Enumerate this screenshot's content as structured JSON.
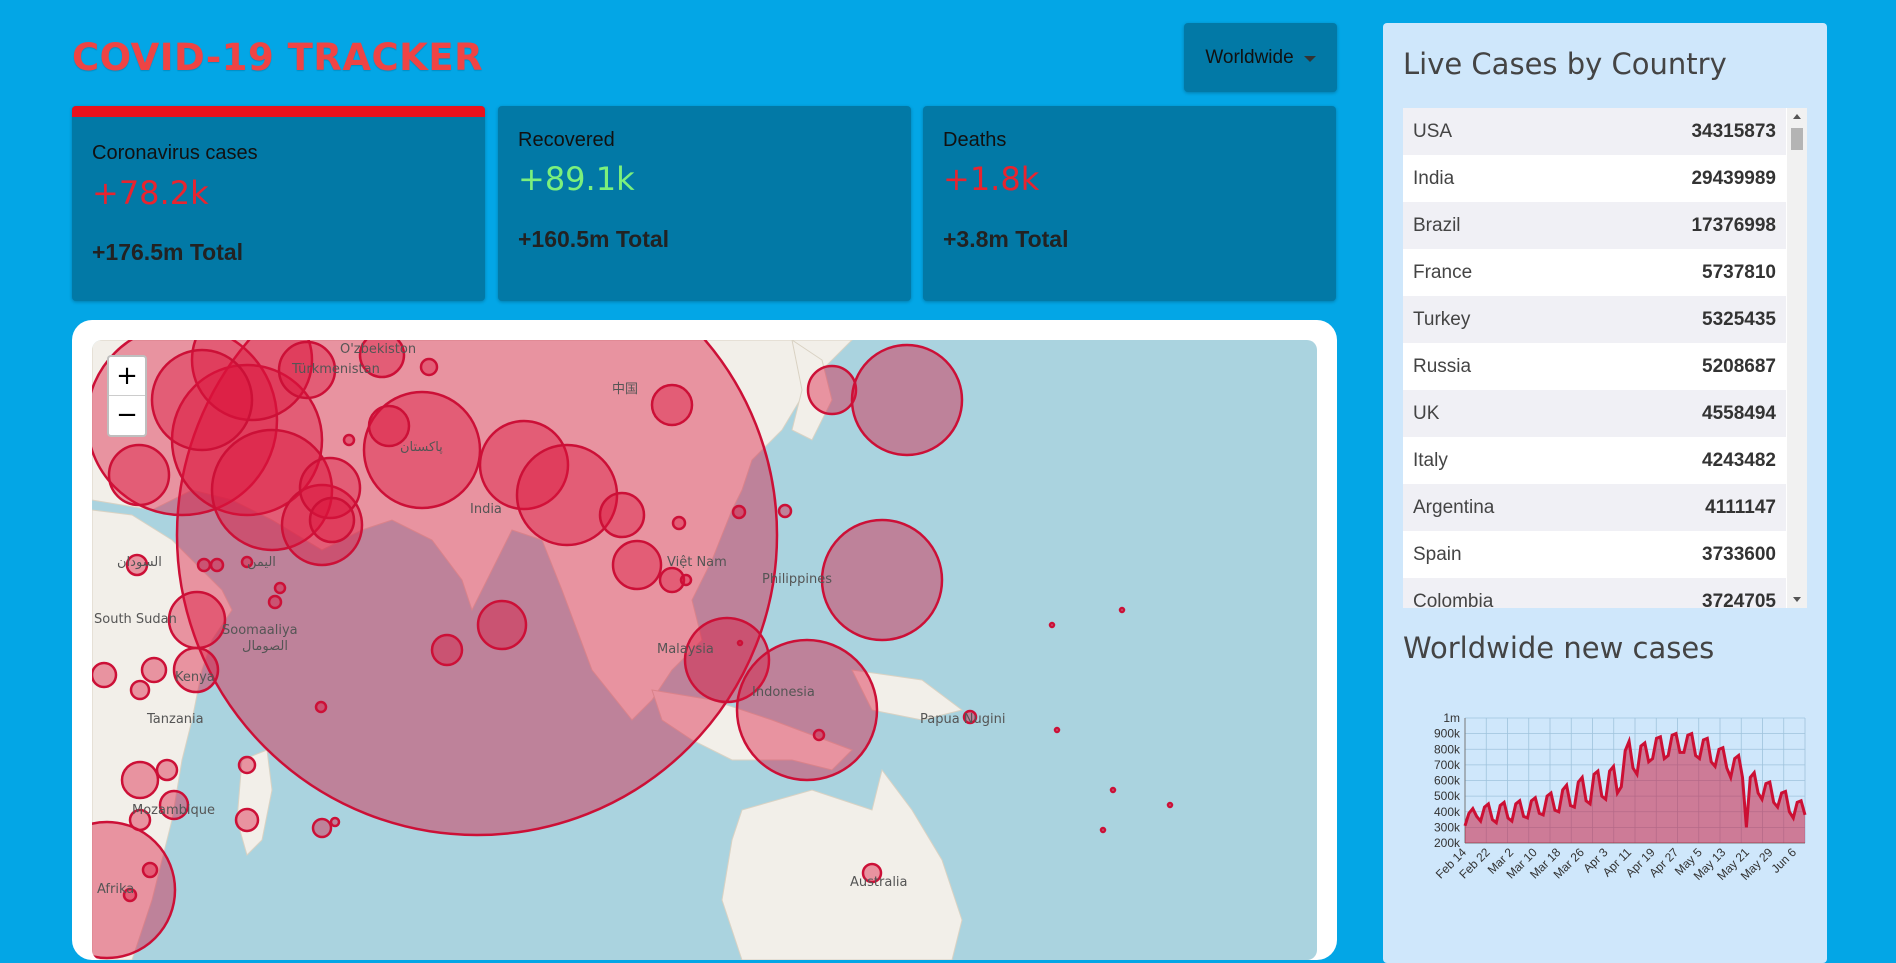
{
  "header": {
    "title": "COVID-19 TRACKER",
    "country_select": "Worldwide"
  },
  "stats": [
    {
      "label": "Coronavirus cases",
      "value": "+78.2k",
      "total": "+176.5m Total",
      "value_color": "#e8242f",
      "active": true
    },
    {
      "label": "Recovered",
      "value": "+89.1k",
      "total": "+160.5m Total",
      "value_color": "#7cf07c",
      "active": false
    },
    {
      "label": "Deaths",
      "value": "+1.8k",
      "total": "+3.8m Total",
      "value_color": "#e8242f",
      "active": false
    }
  ],
  "map": {
    "zoom_in": "+",
    "zoom_out": "−",
    "labels": [
      "O'zbekiston",
      "Türkmenistan",
      "中国",
      "پاکستان",
      "India",
      "Việt Nam",
      "Philippines",
      "Malaysia",
      "Indonesia",
      "Papua Nugini",
      "Australia",
      "South Sudan",
      "Soomaaliya",
      "الصومال",
      "Kenya",
      "Tanzania",
      "Mozambique",
      "Afrika",
      "السودان",
      "اليمن"
    ]
  },
  "sidebar": {
    "table_title": "Live Cases by Country",
    "countries": [
      {
        "name": "USA",
        "cases": "34315873"
      },
      {
        "name": "India",
        "cases": "29439989"
      },
      {
        "name": "Brazil",
        "cases": "17376998"
      },
      {
        "name": "France",
        "cases": "5737810"
      },
      {
        "name": "Turkey",
        "cases": "5325435"
      },
      {
        "name": "Russia",
        "cases": "5208687"
      },
      {
        "name": "UK",
        "cases": "4558494"
      },
      {
        "name": "Italy",
        "cases": "4243482"
      },
      {
        "name": "Argentina",
        "cases": "4111147"
      },
      {
        "name": "Spain",
        "cases": "3733600"
      },
      {
        "name": "Colombia",
        "cases": "3724705"
      }
    ],
    "chart_title": "Worldwide new cases"
  },
  "colors": {
    "background": "#03a6e6",
    "card": "#0279a6",
    "accent_red": "#e8121d",
    "map_circle": "#dc143c"
  },
  "chart_data": {
    "type": "area",
    "title": "Worldwide new cases",
    "xlabel": "",
    "ylabel": "",
    "ylim": [
      200000,
      1000000
    ],
    "ytick_labels": [
      "200k",
      "300k",
      "400k",
      "500k",
      "600k",
      "700k",
      "800k",
      "900k",
      "1m"
    ],
    "xtick_labels": [
      "Feb 14",
      "Feb 22",
      "Mar 2",
      "Mar 10",
      "Mar 18",
      "Mar 26",
      "Apr 3",
      "Apr 11",
      "Apr 19",
      "Apr 27",
      "May 5",
      "May 13",
      "May 21",
      "May 29",
      "Jun 6"
    ],
    "series": [
      {
        "values": [
          310000,
          390000,
          420000,
          370000,
          340000,
          430000,
          450000,
          350000,
          330000,
          440000,
          460000,
          360000,
          340000,
          450000,
          470000,
          370000,
          360000,
          470000,
          490000,
          390000,
          380000,
          500000,
          520000,
          410000,
          400000,
          540000,
          570000,
          440000,
          430000,
          590000,
          620000,
          470000,
          450000,
          640000,
          660000,
          500000,
          480000,
          660000,
          690000,
          520000,
          560000,
          790000,
          850000,
          680000,
          640000,
          820000,
          840000,
          720000,
          740000,
          870000,
          880000,
          740000,
          760000,
          890000,
          900000,
          780000,
          780000,
          890000,
          900000,
          760000,
          740000,
          860000,
          870000,
          720000,
          690000,
          800000,
          810000,
          680000,
          620000,
          740000,
          760000,
          620000,
          300000,
          620000,
          650000,
          520000,
          480000,
          580000,
          590000,
          460000,
          430000,
          520000,
          530000,
          400000,
          360000,
          460000,
          470000,
          380000
        ]
      }
    ]
  }
}
